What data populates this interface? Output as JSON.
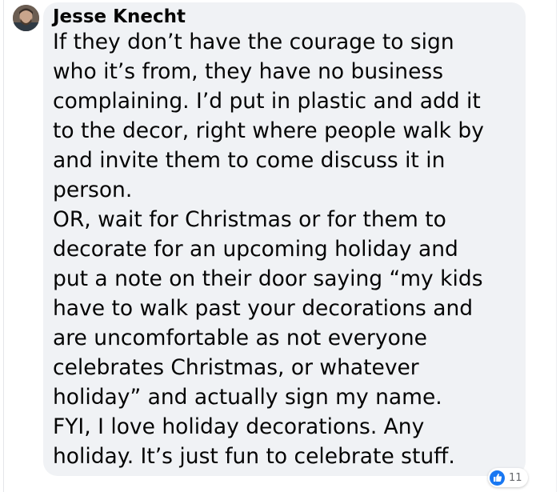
{
  "comment": {
    "author": "Jesse Knecht",
    "lines": [
      "If they don’t have the courage to sign",
      "who it’s from, they have no business",
      "complaining. I’d put in plastic and add it",
      "to the decor, right where people walk by",
      "and invite them to come discuss it in",
      "person.",
      "OR, wait for Christmas or for them to",
      "decorate for an upcoming holiday and",
      "put a note on their door saying “my kids",
      "have to walk past your decorations and",
      "are uncomfortable as not everyone",
      "celebrates Christmas, or whatever",
      "holiday” and actually sign my name.",
      "FYI, I love holiday decorations. Any",
      "holiday. It’s just fun to celebrate stuff."
    ],
    "reaction": {
      "icon": "thumbs-up-icon",
      "count": "11"
    }
  },
  "colors": {
    "bubble": "#f0f2f5",
    "text": "#050505",
    "like_blue": "#1877f2",
    "count_gray": "#65676b"
  }
}
